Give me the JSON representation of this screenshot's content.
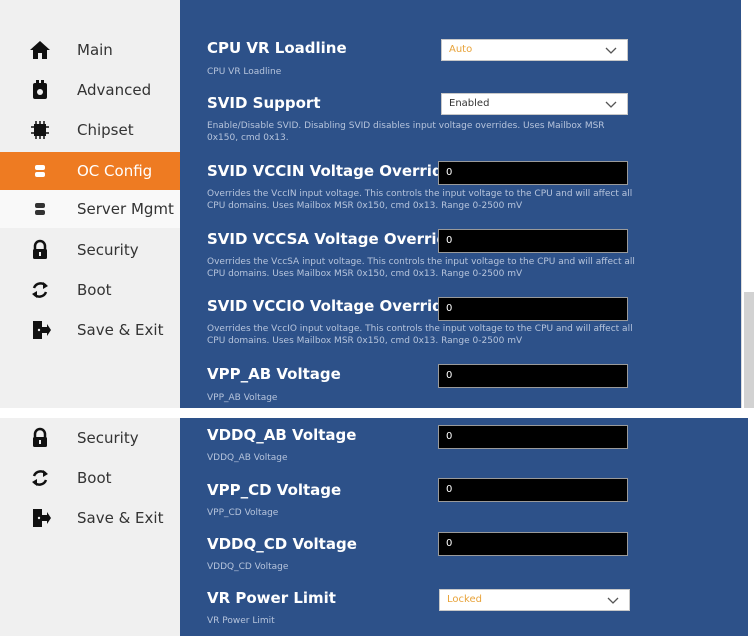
{
  "top": {
    "sidebar": [
      {
        "label": "Main",
        "icon": "home-icon"
      },
      {
        "label": "Advanced",
        "icon": "advanced-icon"
      },
      {
        "label": "Chipset",
        "icon": "chip-icon"
      },
      {
        "label": "OC Config",
        "icon": "oc-config-icon",
        "active": true
      },
      {
        "label": "Server Mgmt",
        "icon": "server-icon"
      },
      {
        "label": "Security",
        "icon": "lock-icon"
      },
      {
        "label": "Boot",
        "icon": "boot-icon"
      },
      {
        "label": "Save & Exit",
        "icon": "exit-icon"
      }
    ],
    "settings": [
      {
        "title": "CPU VR Loadline",
        "desc": "CPU VR Loadline",
        "control": "select",
        "value": "Auto"
      },
      {
        "title": "SVID Support",
        "desc": "Enable/Disable SVID. Disabling SVID disables input voltage overrides. Uses Mailbox MSR 0x150, cmd 0x13.",
        "control": "select",
        "value": "Enabled"
      },
      {
        "title": "SVID VCCIN Voltage Override",
        "desc": "Overrides the VccIN input voltage. This controls the input voltage to the CPU and will affect all CPU domains. Uses Mailbox MSR 0x150, cmd 0x13. Range 0-2500 mV",
        "control": "input",
        "value": "0"
      },
      {
        "title": "SVID VCCSA Voltage Override",
        "desc": "Overrides the VccSA input voltage. This controls the input voltage to the CPU and will affect all CPU domains. Uses Mailbox MSR 0x150, cmd 0x13. Range 0-2500 mV",
        "control": "input",
        "value": "0"
      },
      {
        "title": "SVID VCCIO Voltage Override",
        "desc": "Overrides the VccIO input voltage. This controls the input voltage to the CPU and will affect all CPU domains. Uses Mailbox MSR 0x150, cmd 0x13. Range 0-2500 mV",
        "control": "input",
        "value": "0"
      },
      {
        "title": "VPP_AB Voltage",
        "desc": "VPP_AB Voltage",
        "control": "input",
        "value": "0"
      }
    ]
  },
  "bottom": {
    "sidebar": [
      {
        "label": "Security",
        "icon": "lock-icon"
      },
      {
        "label": "Boot",
        "icon": "boot-icon"
      },
      {
        "label": "Save & Exit",
        "icon": "exit-icon"
      }
    ],
    "settings": [
      {
        "title": "VDDQ_AB Voltage",
        "desc": "VDDQ_AB Voltage",
        "control": "input",
        "value": "0"
      },
      {
        "title": "VPP_CD Voltage",
        "desc": "VPP_CD Voltage",
        "control": "input",
        "value": "0"
      },
      {
        "title": "VDDQ_CD Voltage",
        "desc": "VDDQ_CD Voltage",
        "control": "input",
        "value": "0"
      },
      {
        "title": "VR Power Limit",
        "desc": "VR Power Limit",
        "control": "select",
        "value": "Locked"
      }
    ]
  },
  "colors": {
    "accent": "#ee7b22",
    "panel_bg": "#2d5189",
    "sidebar_bg": "#f0f0f0",
    "muted_select_text": "#e8a33a",
    "normal_select_text": "#333333"
  }
}
